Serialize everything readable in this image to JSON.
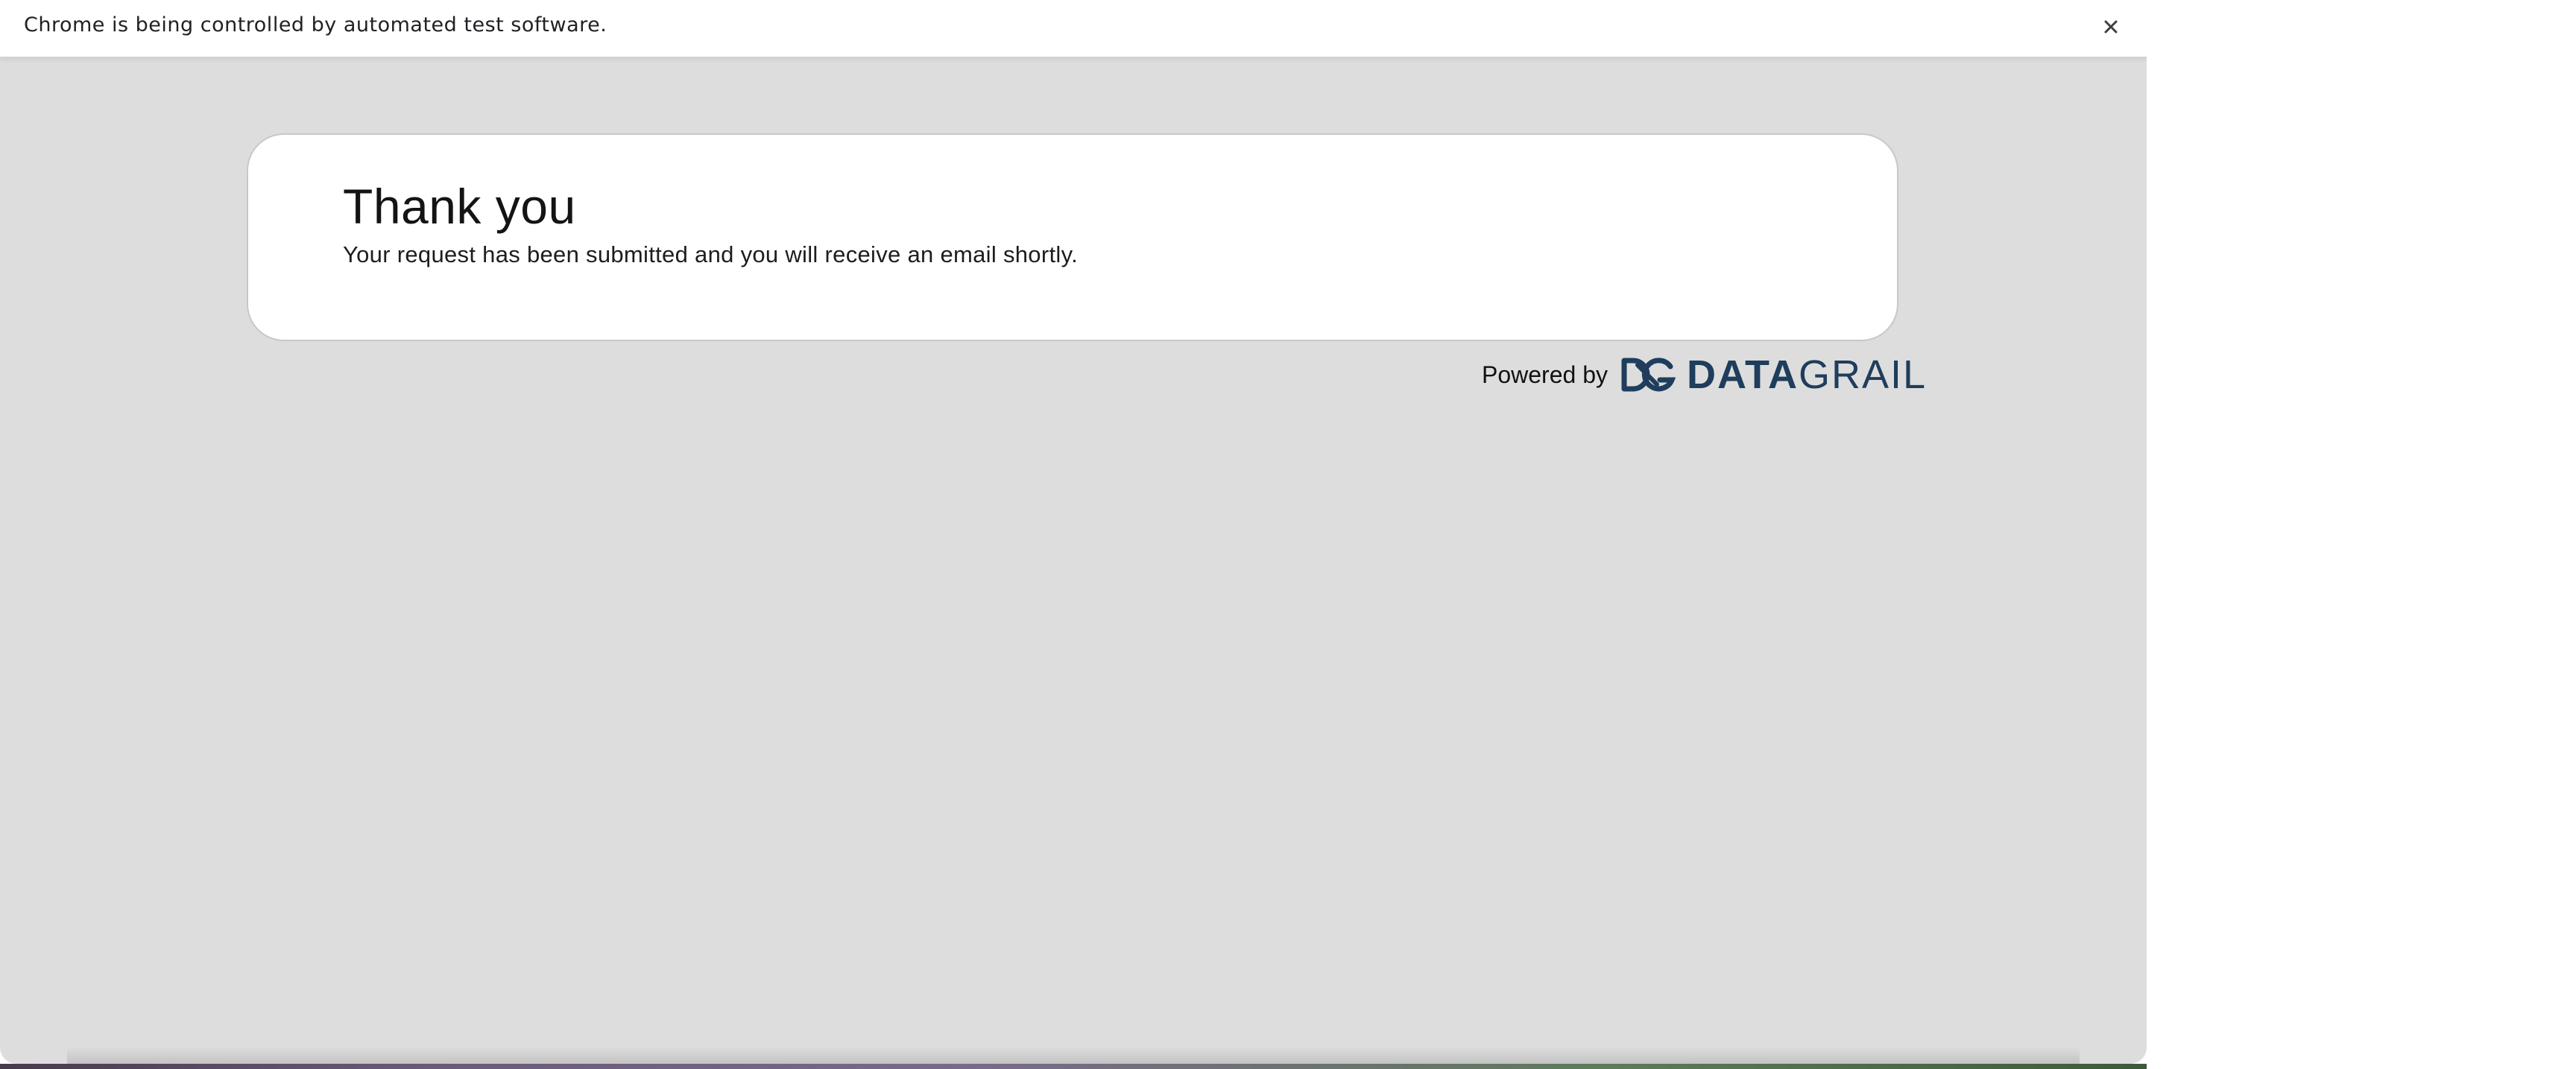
{
  "infobar": {
    "message": "Chrome is being controlled by automated test software.",
    "close_icon": "close-icon"
  },
  "confirmation": {
    "title": "Thank you",
    "message": "Your request has been submitted and you will receive an email shortly."
  },
  "footer": {
    "powered_by_label": "Powered by",
    "brand_logo": {
      "icon": "datagrail-dg-mark",
      "wordmark_bold": "DATA",
      "wordmark_light": "GRAIL",
      "color": "#1f3d5c"
    }
  },
  "colors": {
    "page_background": "#dddddd",
    "card_background": "#ffffff",
    "brand": "#1f3d5c"
  }
}
